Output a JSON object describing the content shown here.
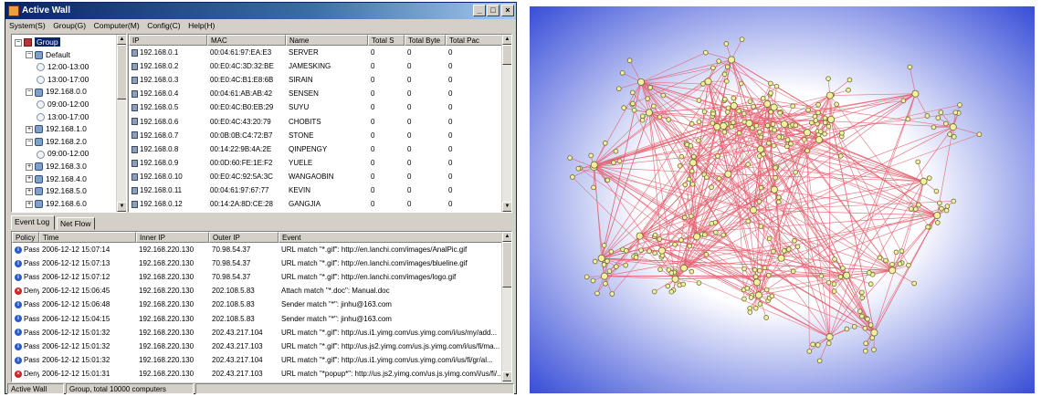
{
  "window": {
    "title": "Active Wall",
    "controls": {
      "minimize": "_",
      "maximize": "□",
      "close": "×"
    }
  },
  "menu": [
    "System(S)",
    "Group(G)",
    "Computer(M)",
    "Config(C)",
    "Help(H)"
  ],
  "tree": [
    {
      "label": "Group",
      "level": 0,
      "icon": "group-icon",
      "expander": "−",
      "selected": true
    },
    {
      "label": "Default",
      "level": 1,
      "icon": "network-icon",
      "expander": "−"
    },
    {
      "label": "12:00-13:00",
      "level": 2,
      "icon": "clock-icon"
    },
    {
      "label": "13:00-17:00",
      "level": 2,
      "icon": "clock-icon"
    },
    {
      "label": "192.168.0.0",
      "level": 1,
      "icon": "network-icon",
      "expander": "−"
    },
    {
      "label": "09:00-12:00",
      "level": 2,
      "icon": "clock-icon"
    },
    {
      "label": "13:00-17:00",
      "level": 2,
      "icon": "clock-icon"
    },
    {
      "label": "192.168.1.0",
      "level": 1,
      "icon": "network-icon",
      "expander": "+"
    },
    {
      "label": "192.168.2.0",
      "level": 1,
      "icon": "network-icon",
      "expander": "−"
    },
    {
      "label": "09:00-12:00",
      "level": 2,
      "icon": "clock-icon"
    },
    {
      "label": "192.168.3.0",
      "level": 1,
      "icon": "network-icon",
      "expander": "+"
    },
    {
      "label": "192.168.4.0",
      "level": 1,
      "icon": "network-icon",
      "expander": "+"
    },
    {
      "label": "192.168.5.0",
      "level": 1,
      "icon": "network-icon",
      "expander": "+"
    },
    {
      "label": "192.168.6.0",
      "level": 1,
      "icon": "network-icon",
      "expander": "+"
    }
  ],
  "hosts": {
    "columns": [
      "IP",
      "MAC",
      "Name",
      "Total S",
      "Total Byte",
      "Total Pac"
    ],
    "rows": [
      [
        "192.168.0.1",
        "00:04:61:97:EA:E3",
        "SERVER",
        "0",
        "0",
        "0"
      ],
      [
        "192.168.0.2",
        "00:E0:4C:3D:32:BE",
        "JAMESKING",
        "0",
        "0",
        "0"
      ],
      [
        "192.168.0.3",
        "00:E0:4C:B1:E8:6B",
        "SIRAIN",
        "0",
        "0",
        "0"
      ],
      [
        "192.168.0.4",
        "00:04:61:AB:AB:42",
        "SENSEN",
        "0",
        "0",
        "0"
      ],
      [
        "192.168.0.5",
        "00:E0:4C:B0:EB:29",
        "SUYU",
        "0",
        "0",
        "0"
      ],
      [
        "192.168.0.6",
        "00:E0:4C:43:20:79",
        "CHOBITS",
        "0",
        "0",
        "0"
      ],
      [
        "192.168.0.7",
        "00:0B:0B:C4:72:B7",
        "STONE",
        "0",
        "0",
        "0"
      ],
      [
        "192.168.0.8",
        "00:14:22:9B:4A:2E",
        "QINPENGY",
        "0",
        "0",
        "0"
      ],
      [
        "192.168.0.9",
        "00:0D:60:FE:1E:F2",
        "YUELE",
        "0",
        "0",
        "0"
      ],
      [
        "192.168.0.10",
        "00:E0:4C:92:5A:3C",
        "WANGAOBIN",
        "0",
        "0",
        "0"
      ],
      [
        "192.168.0.11",
        "00:04:61:97:67:77",
        "KEVIN",
        "0",
        "0",
        "0"
      ],
      [
        "192.168.0.12",
        "00:14:2A:8D:CE:28",
        "GANGJIA",
        "0",
        "0",
        "0"
      ]
    ]
  },
  "tabs": [
    "Event Log",
    "Net Flow"
  ],
  "events": {
    "columns": [
      "Policy",
      "Time",
      "Inner IP",
      "Outer IP",
      "Event"
    ],
    "rows": [
      [
        "Pass",
        "2006-12-12 15:07:14",
        "192.168.220.130",
        "70.98.54.37",
        "URL match \"*.gif\": http://en.lanchi.com/images/AnalPic.gif"
      ],
      [
        "Pass",
        "2006-12-12 15:07:13",
        "192.168.220.130",
        "70.98.54.37",
        "URL match \"*.gif\": http://en.lanchi.com/images/blueline.gif"
      ],
      [
        "Pass",
        "2006-12-12 15:07:12",
        "192.168.220.130",
        "70.98.54.37",
        "URL match \"*.gif\": http://en.lanchi.com/images/logo.gif"
      ],
      [
        "Deny",
        "2006-12-12 15:06:45",
        "192.168.220.130",
        "202.108.5.83",
        "Attach match \"*.doc\": Manual.doc"
      ],
      [
        "Pass",
        "2006-12-12 15:06:48",
        "192.168.220.130",
        "202.108.5.83",
        "Sender match \"*\": jinhu@163.com"
      ],
      [
        "Pass",
        "2006-12-12 15:04:15",
        "192.168.220.130",
        "202.108.5.83",
        "Sender match \"*\": jinhu@163.com"
      ],
      [
        "Pass",
        "2006-12-12 15:01:32",
        "192.168.220.130",
        "202.43.217.104",
        "URL match \"*.gif\": http://us.i1.yimg.com/us.yimg.com/i/us/my/add..."
      ],
      [
        "Pass",
        "2006-12-12 15:01:32",
        "192.168.220.130",
        "202.43.217.103",
        "URL match \"*.gif\": http://us.js2.yimg.com/us.js.yimg.com/i/us/fi/ma..."
      ],
      [
        "Pass",
        "2006-12-12 15:01:32",
        "192.168.220.130",
        "202.43.217.104",
        "URL match \"*.gif\": http://us.i1.yimg.com/us.yimg.com/i/us/fi/gr/al..."
      ],
      [
        "Deny",
        "2006-12-12 15:01:31",
        "192.168.220.130",
        "202.43.217.103",
        "URL match \"*popup*\": http://us.js2.yimg.com/us.js.yimg.com/i/us/fi/..."
      ]
    ]
  },
  "status": [
    "Active Wall",
    "Group, total 10000 computers"
  ],
  "colors": {
    "pass": "#2a5cc8",
    "deny": "#cc2222",
    "edge": "#e66070",
    "node": "#f4f0a0",
    "node_border": "#6a6a30",
    "graph_bg_center": "#ffffff",
    "graph_bg_edge": "#3a50d8"
  }
}
